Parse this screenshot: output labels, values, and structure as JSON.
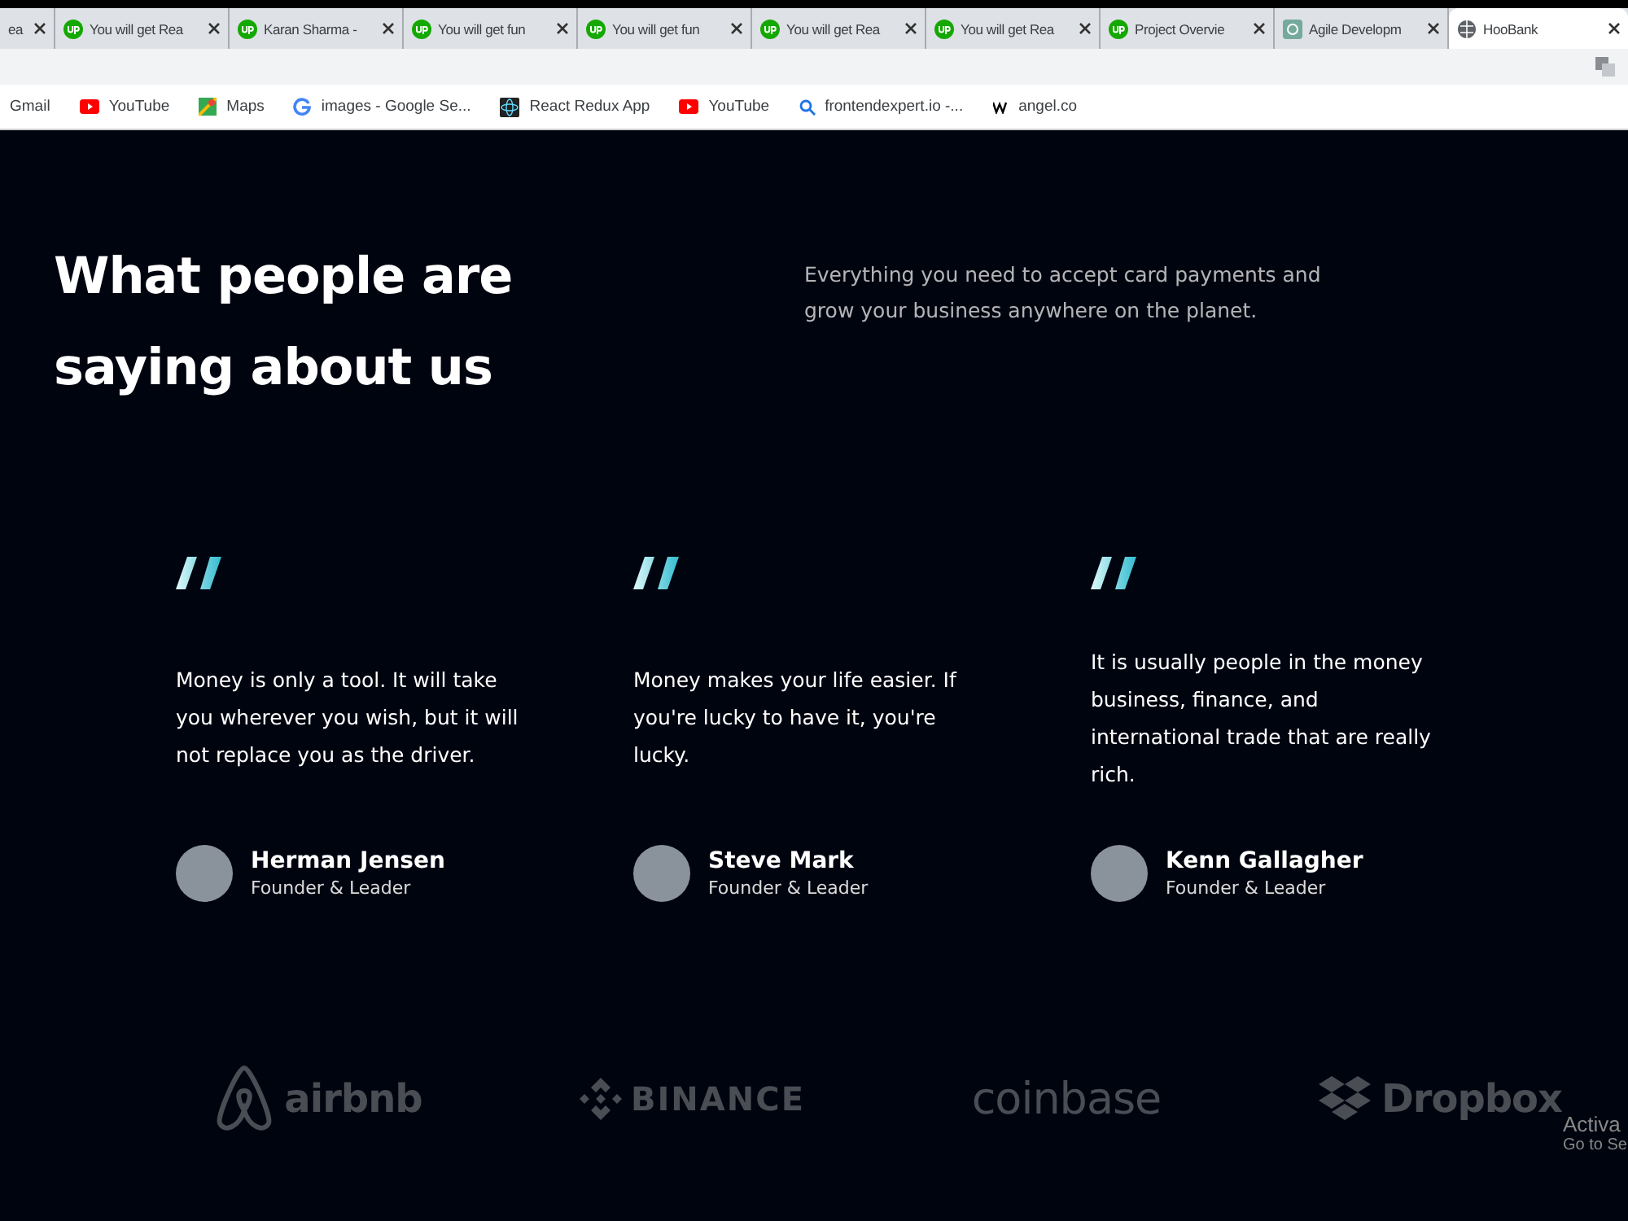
{
  "tabs": [
    {
      "title": "ea",
      "selected": false,
      "kind": "page"
    },
    {
      "title": "You will get Rea",
      "selected": false,
      "kind": "upwork"
    },
    {
      "title": "Karan Sharma -",
      "selected": false,
      "kind": "upwork"
    },
    {
      "title": "You will get fun",
      "selected": false,
      "kind": "upwork"
    },
    {
      "title": "You will get fun",
      "selected": false,
      "kind": "upwork"
    },
    {
      "title": "You will get Rea",
      "selected": false,
      "kind": "upwork"
    },
    {
      "title": "You will get Rea",
      "selected": false,
      "kind": "upwork"
    },
    {
      "title": "Project Overvie",
      "selected": false,
      "kind": "upwork"
    },
    {
      "title": "Agile Developm",
      "selected": false,
      "kind": "ai"
    },
    {
      "title": "HooBank",
      "selected": true,
      "kind": "globe"
    }
  ],
  "bookmarks": [
    {
      "label": "Gmail",
      "kind": "gmail"
    },
    {
      "label": "YouTube",
      "kind": "youtube"
    },
    {
      "label": "Maps",
      "kind": "maps"
    },
    {
      "label": "images - Google Se...",
      "kind": "google"
    },
    {
      "label": "React Redux App",
      "kind": "react"
    },
    {
      "label": "YouTube",
      "kind": "youtube"
    },
    {
      "label": "frontendexpert.io -...",
      "kind": "search"
    },
    {
      "label": "angel.co",
      "kind": "angel"
    }
  ],
  "section": {
    "heading": "What people are saying about us",
    "intro": "Everything you need to accept card payments and grow your business anywhere on the planet."
  },
  "testimonials": [
    {
      "quote": "Money is only a tool. It will take you wherever you wish, but it will not replace you as the driver.",
      "name": "Herman Jensen",
      "title": "Founder & Leader"
    },
    {
      "quote": "Money makes your life easier. If you're lucky to have it, you're lucky.",
      "name": "Steve Mark",
      "title": "Founder & Leader"
    },
    {
      "quote": "It is usually people in the money business, finance, and international trade that are really rich.",
      "name": "Kenn Gallagher",
      "title": "Founder & Leader"
    }
  ],
  "clients": [
    {
      "name": "airbnb",
      "kind": "airbnb"
    },
    {
      "name": "BINANCE",
      "kind": "binance"
    },
    {
      "name": "coinbase",
      "kind": "coinbase"
    },
    {
      "name": "Dropbox",
      "kind": "dropbox"
    }
  ],
  "activation": {
    "title": "Activa",
    "subtitle": "Go to Se"
  }
}
